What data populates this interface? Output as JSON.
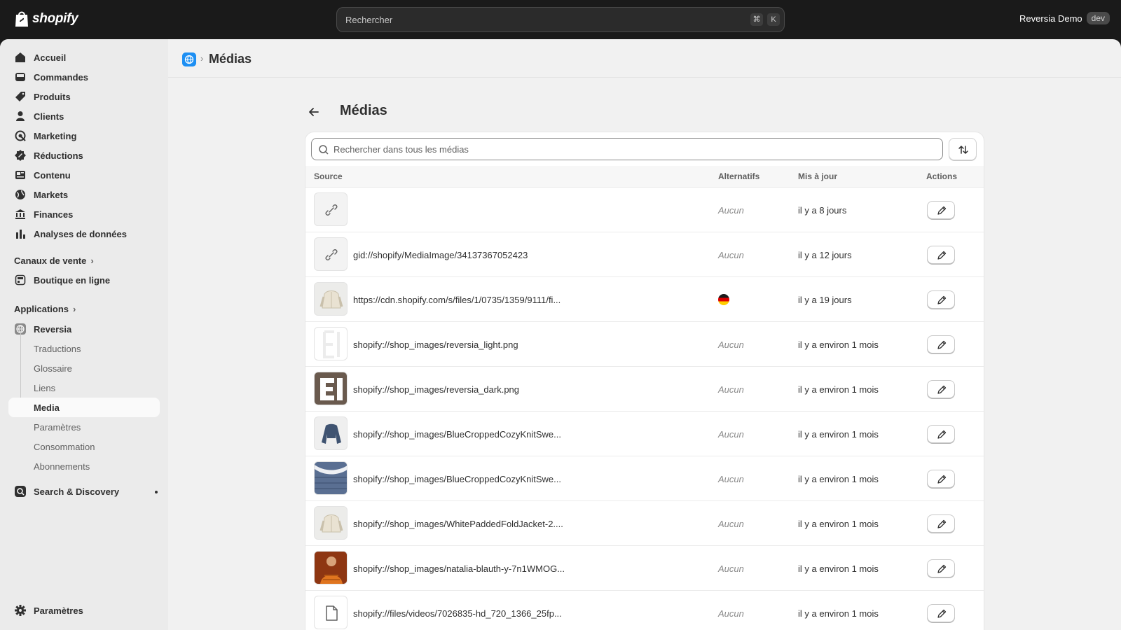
{
  "topbar": {
    "logo_text": "shopify",
    "search_placeholder": "Rechercher",
    "shortcut_cmd": "⌘",
    "shortcut_key": "K",
    "store_name": "Reversia Demo",
    "store_badge": "dev"
  },
  "sidebar": {
    "main_items": [
      {
        "label": "Accueil",
        "icon": "home-icon"
      },
      {
        "label": "Commandes",
        "icon": "inbox-icon"
      },
      {
        "label": "Produits",
        "icon": "tag-icon"
      },
      {
        "label": "Clients",
        "icon": "person-icon"
      },
      {
        "label": "Marketing",
        "icon": "target-icon"
      },
      {
        "label": "Réductions",
        "icon": "discount-icon"
      },
      {
        "label": "Contenu",
        "icon": "content-icon"
      },
      {
        "label": "Markets",
        "icon": "globe-icon"
      },
      {
        "label": "Finances",
        "icon": "bank-icon"
      },
      {
        "label": "Analyses de données",
        "icon": "bar-chart-icon"
      }
    ],
    "sales_channels_label": "Canaux de vente",
    "online_store_label": "Boutique en ligne",
    "apps_label": "Applications",
    "app_name": "Reversia",
    "app_sub_items": [
      "Traductions",
      "Glossaire",
      "Liens",
      "Media",
      "Paramètres",
      "Consommation",
      "Abonnements"
    ],
    "app_active_item": "Media",
    "search_discovery_label": "Search & Discovery",
    "settings_label": "Paramètres"
  },
  "breadcrumb": {
    "separator": "›",
    "title": "Médias"
  },
  "page": {
    "title": "Médias",
    "search_placeholder": "Rechercher dans tous les médias",
    "columns": {
      "source": "Source",
      "alternatives": "Alternatifs",
      "updated": "Mis à jour",
      "actions": "Actions"
    },
    "rows": [
      {
        "source": "",
        "alternatives": "Aucun",
        "updated": "il y a 8 jours",
        "thumb": "link"
      },
      {
        "source": "gid://shopify/MediaImage/34137367052423",
        "alternatives": "Aucun",
        "updated": "il y a 12 jours",
        "thumb": "link"
      },
      {
        "source": "https://cdn.shopify.com/s/files/1/0735/1359/9111/fi...",
        "alternatives": "",
        "alt_flag": "germany-flag-icon",
        "updated": "il y a 19 jours",
        "thumb": "white-jacket"
      },
      {
        "source": "shopify://shop_images/reversia_light.png",
        "alternatives": "Aucun",
        "updated": "il y a environ 1 mois",
        "thumb": "logo-light"
      },
      {
        "source": "shopify://shop_images/reversia_dark.png",
        "alternatives": "Aucun",
        "updated": "il y a environ 1 mois",
        "thumb": "logo-dark"
      },
      {
        "source": "shopify://shop_images/BlueCroppedCozyKnitSwe...",
        "alternatives": "Aucun",
        "updated": "il y a environ 1 mois",
        "thumb": "blue-sweater"
      },
      {
        "source": "shopify://shop_images/BlueCroppedCozyKnitSwe...",
        "alternatives": "Aucun",
        "updated": "il y a environ 1 mois",
        "thumb": "blue-knit"
      },
      {
        "source": "shopify://shop_images/WhitePaddedFoldJacket-2....",
        "alternatives": "Aucun",
        "updated": "il y a environ 1 mois",
        "thumb": "white-jacket"
      },
      {
        "source": "shopify://shop_images/natalia-blauth-y-7n1WMOG...",
        "alternatives": "Aucun",
        "updated": "il y a environ 1 mois",
        "thumb": "orange-photo"
      },
      {
        "source": "shopify://files/videos/7026835-hd_720_1366_25fp...",
        "alternatives": "Aucun",
        "updated": "il y a environ 1 mois",
        "thumb": "file"
      }
    ]
  }
}
